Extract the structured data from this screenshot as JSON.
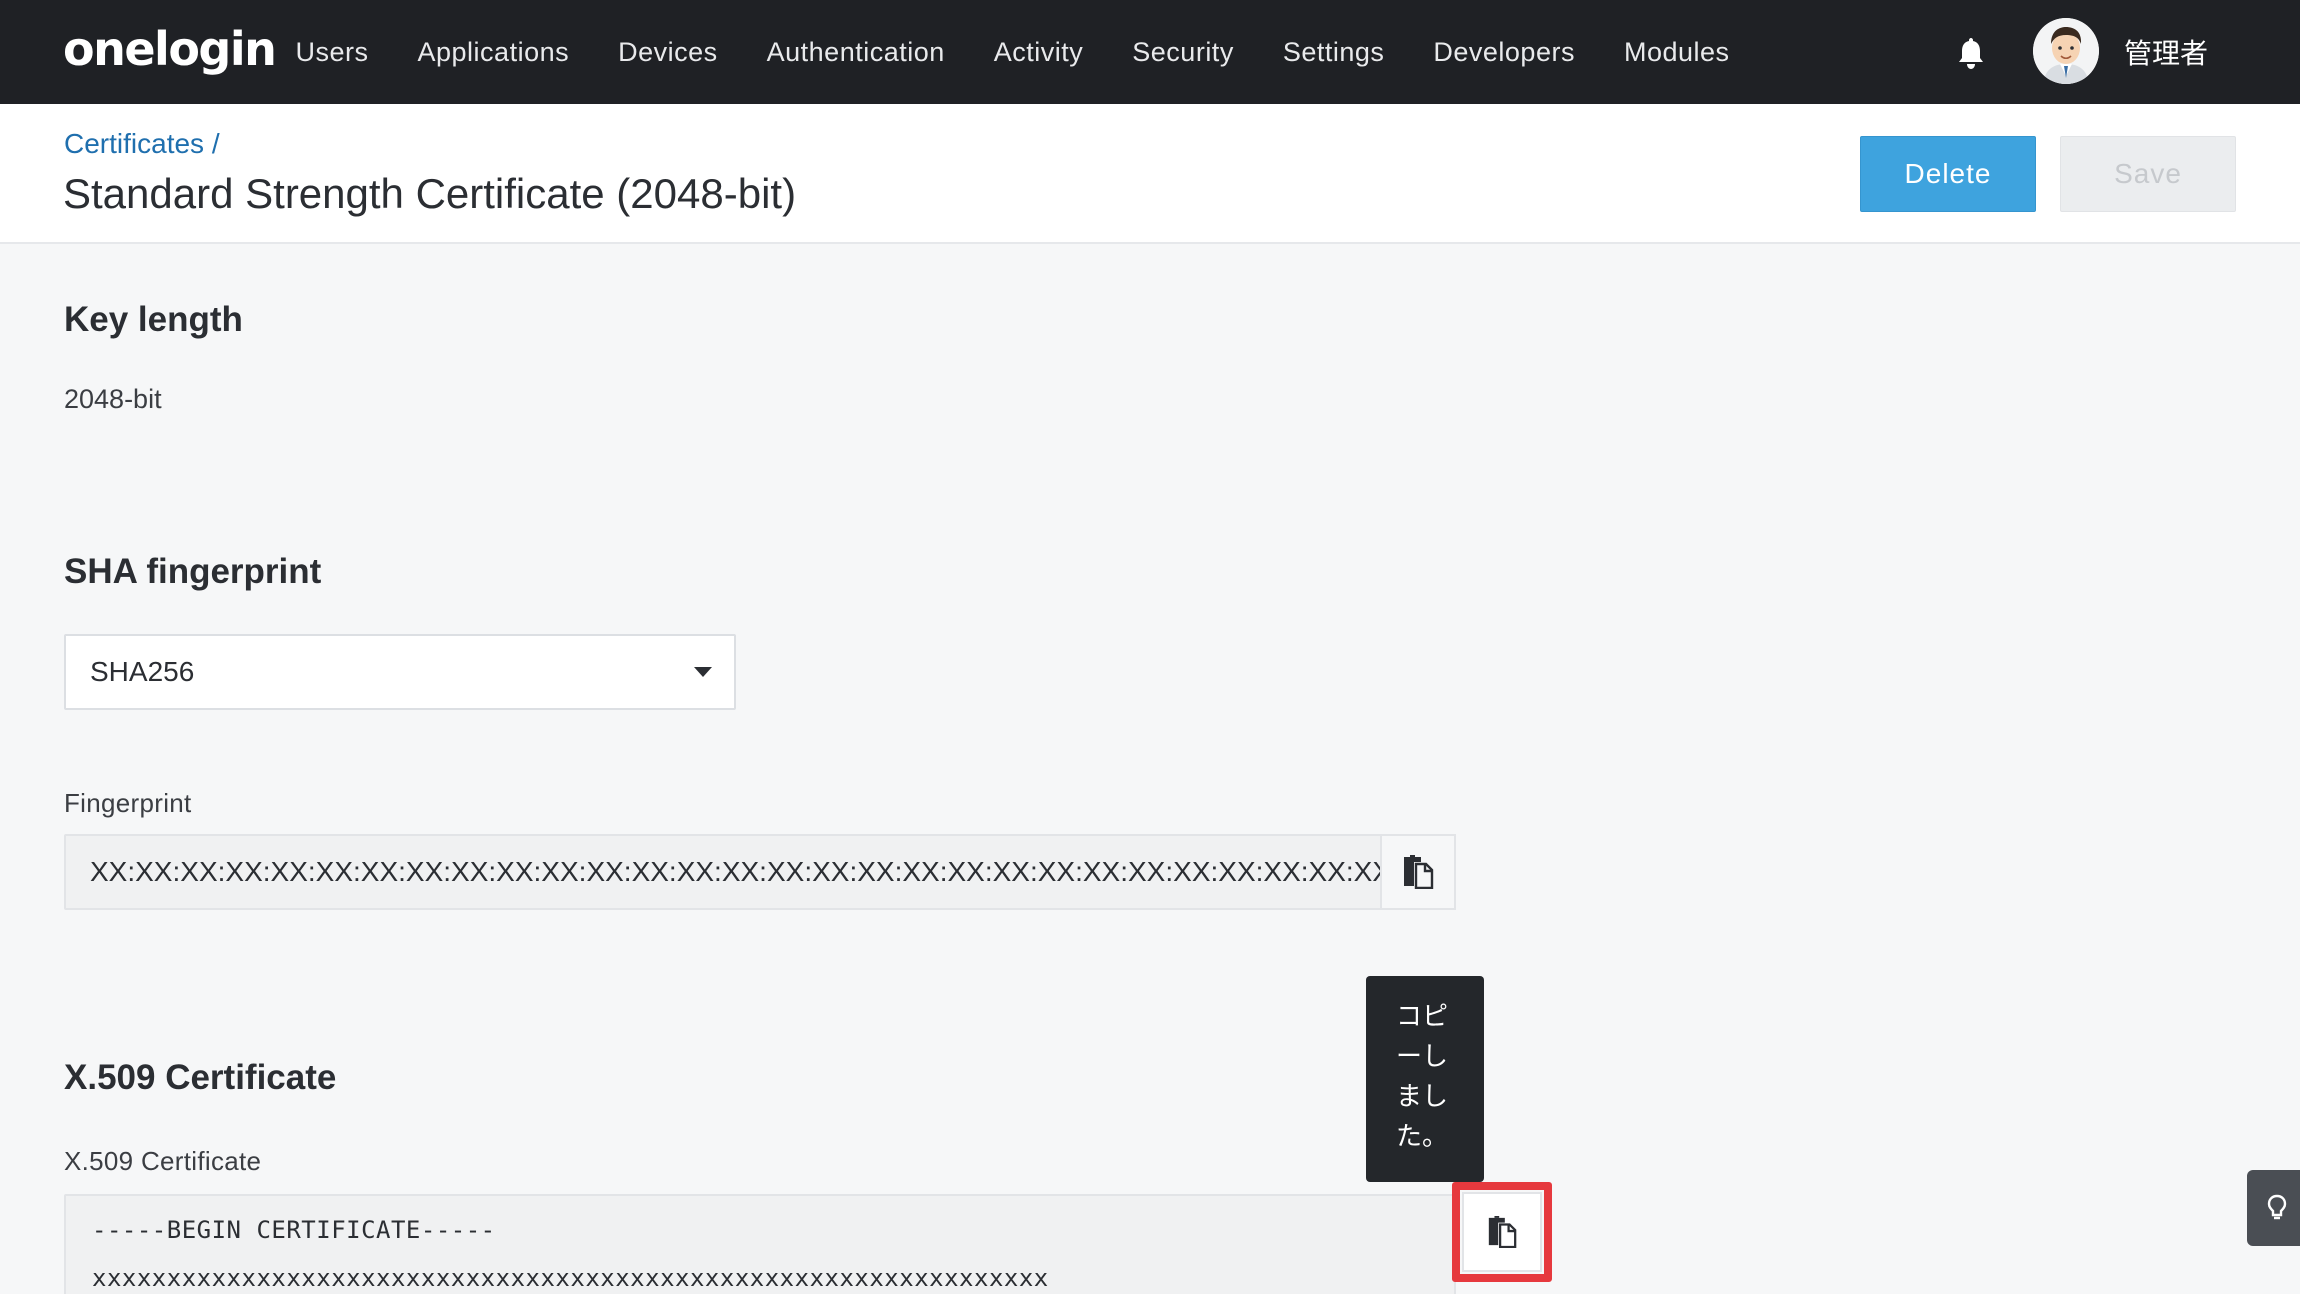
{
  "app": {
    "logo": "onelogin"
  },
  "nav": {
    "items": [
      "Users",
      "Applications",
      "Devices",
      "Authentication",
      "Activity",
      "Security",
      "Settings",
      "Developers",
      "Modules"
    ],
    "icons": {
      "notifications": "bell-icon"
    },
    "username": "管理者"
  },
  "header": {
    "breadcrumb": "Certificates /",
    "title": "Standard Strength Certificate (2048-bit)",
    "delete_label": "Delete",
    "save_label": "Save"
  },
  "key_length": {
    "heading": "Key length",
    "value": "2048-bit"
  },
  "sha": {
    "heading": "SHA fingerprint",
    "selected": "SHA256",
    "fingerprint_label": "Fingerprint",
    "fingerprint_value": "XX:XX:XX:XX:XX:XX:XX:XX:XX:XX:XX:XX:XX:XX:XX:XX:XX:XX:XX:XX:XX:XX:XX:XX:XX:XX:XX:XX:XX:XX:XX:X"
  },
  "tooltip": {
    "lines": [
      "コピ",
      "ーし",
      "まし",
      "た。"
    ]
  },
  "certificate": {
    "heading": "X.509 Certificate",
    "label": "X.509 Certificate",
    "line1": "-----BEGIN CERTIFICATE-----",
    "line2": "xxxxxxxxxxxxxxxxxxxxxxxxxxxxxxxxxxxxxxxxxxxxxxxxxxxxxxxxxxxxxxxx"
  },
  "colors": {
    "nav_bg": "#1f2125",
    "accent": "#3ea3de",
    "link": "#1f6fae",
    "highlight": "#e6393e"
  }
}
